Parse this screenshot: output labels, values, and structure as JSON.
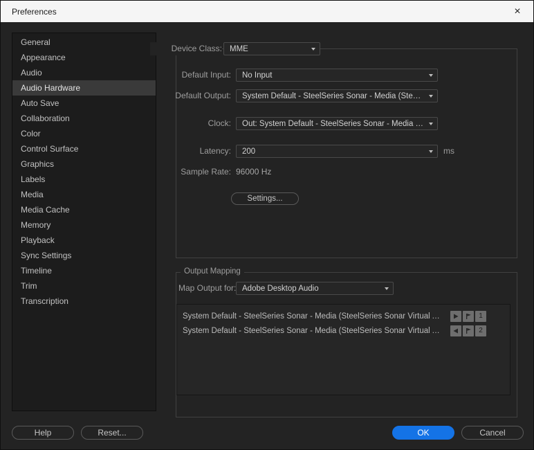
{
  "colors": {
    "accent_blue": "#1473e6",
    "background": "#232323",
    "titlebar": "#f5f5f5"
  },
  "window": {
    "title": "Preferences",
    "close_glyph": "×"
  },
  "sidebar": {
    "items": [
      "General",
      "Appearance",
      "Audio",
      "Audio Hardware",
      "Auto Save",
      "Collaboration",
      "Color",
      "Control Surface",
      "Graphics",
      "Labels",
      "Media",
      "Media Cache",
      "Memory",
      "Playback",
      "Sync Settings",
      "Timeline",
      "Trim",
      "Transcription"
    ],
    "selected": "Audio Hardware"
  },
  "device_class": {
    "label": "Device Class:",
    "value": "MME"
  },
  "audio": {
    "default_input": {
      "label": "Default Input:",
      "value": "No Input"
    },
    "default_output": {
      "label": "Default Output:",
      "value": "System Default - SteelSeries Sonar - Media (SteelSer..."
    },
    "clock": {
      "label": "Clock:",
      "value": "Out: System Default - SteelSeries Sonar - Media (Stee..."
    },
    "latency": {
      "label": "Latency:",
      "value": "200",
      "unit": "ms"
    },
    "sample_rate": {
      "label": "Sample Rate:",
      "value": "96000 Hz"
    },
    "settings_button": "Settings..."
  },
  "output_mapping": {
    "title": "Output Mapping",
    "map_output": {
      "label": "Map Output for:",
      "value": "Adobe Desktop Audio"
    },
    "channels": [
      {
        "name": "System Default - SteelSeries Sonar - Media (SteelSeries Sonar Virtual Audio...",
        "number": "1"
      },
      {
        "name": "System Default - SteelSeries Sonar - Media (SteelSeries Sonar Virtual Audio...",
        "number": "2"
      }
    ]
  },
  "footer": {
    "help": "Help",
    "reset": "Reset...",
    "ok": "OK",
    "cancel": "Cancel"
  }
}
